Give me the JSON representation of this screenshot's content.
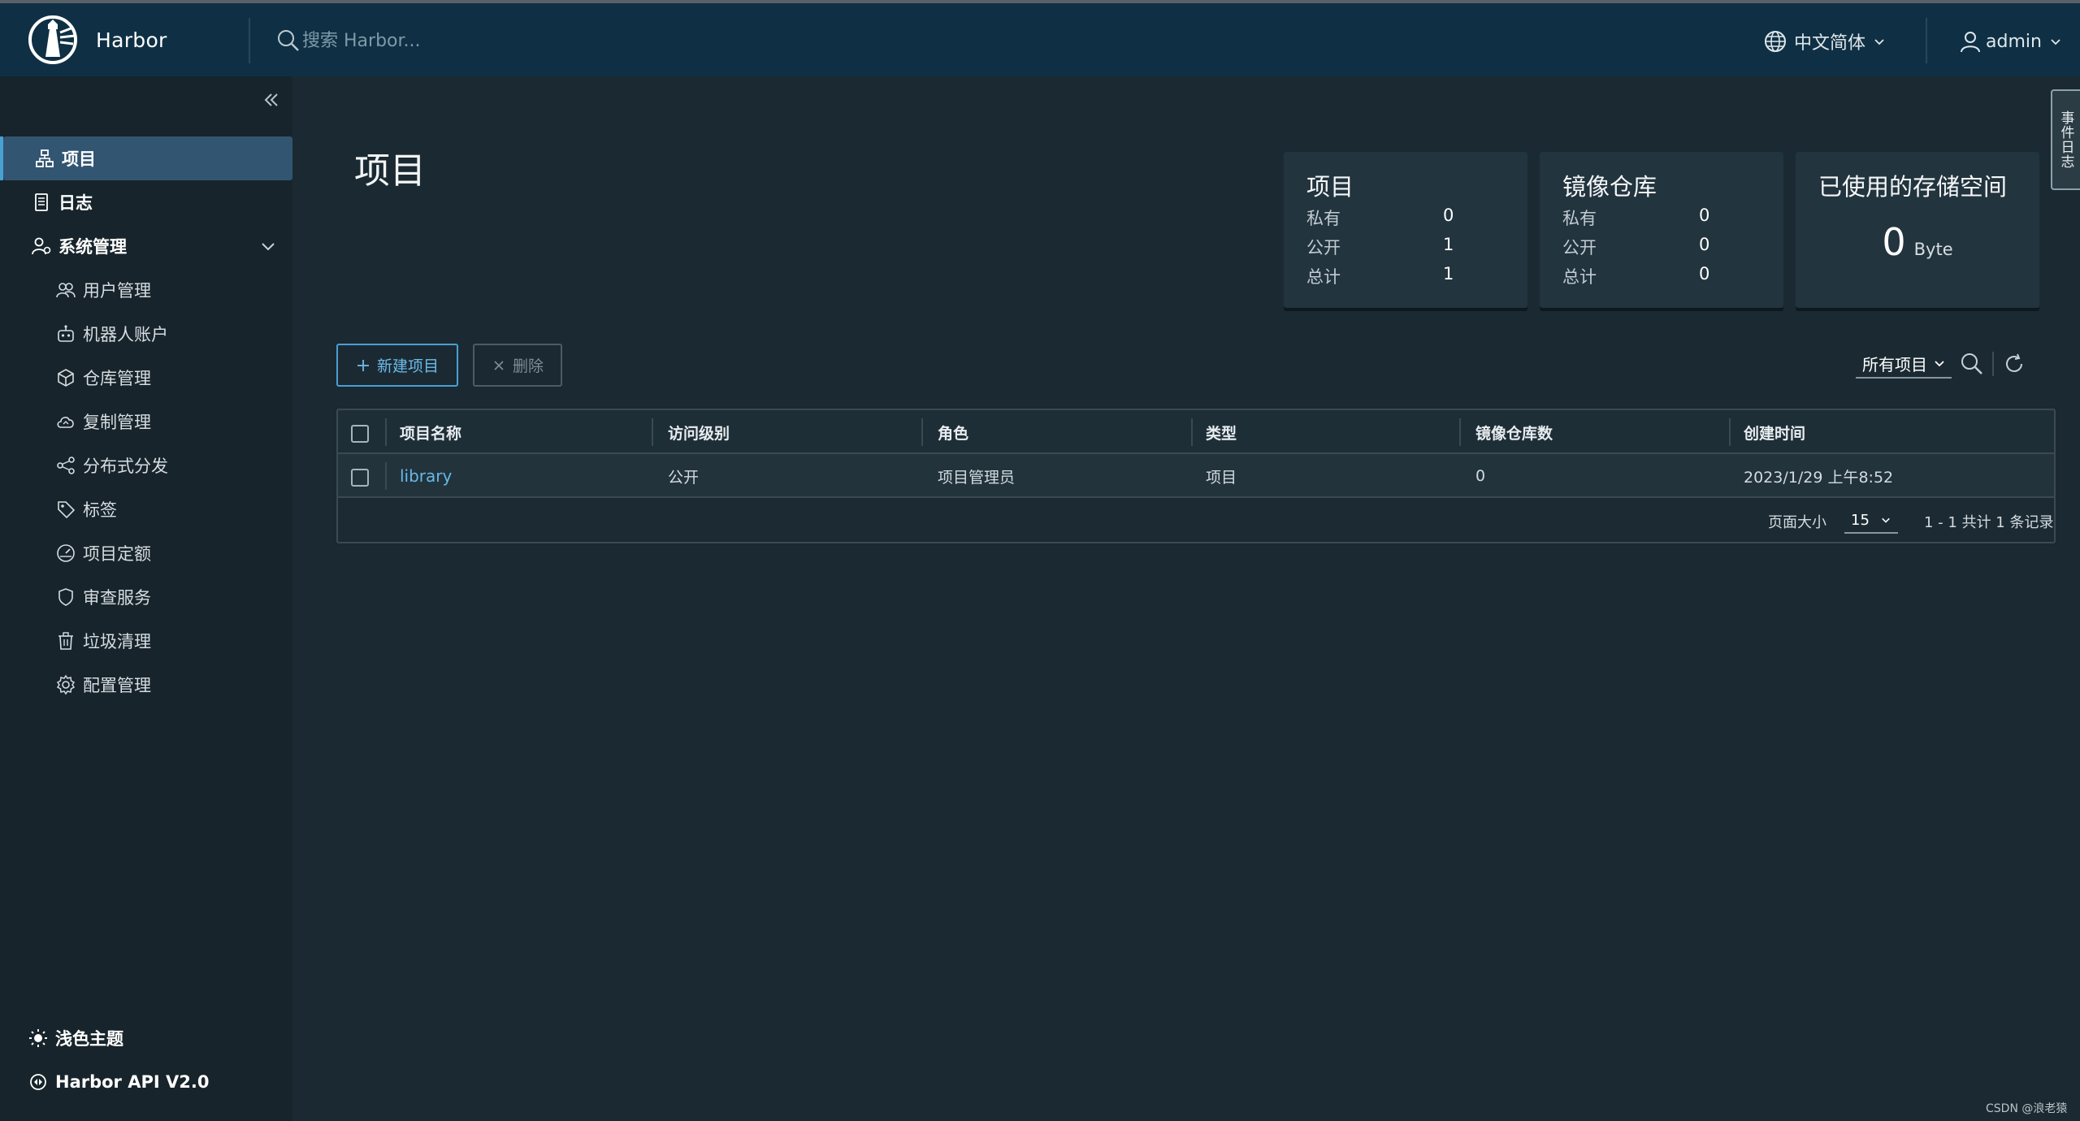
{
  "header": {
    "app_name": "Harbor",
    "search_placeholder": "搜索 Harbor...",
    "language": "中文简体",
    "user": "admin"
  },
  "sidebar": {
    "items": [
      {
        "label": "项目",
        "icon": "project-icon",
        "active": true
      },
      {
        "label": "日志",
        "icon": "log-icon"
      },
      {
        "label": "系统管理",
        "icon": "admin-icon",
        "expanded": true
      }
    ],
    "sub_items": [
      {
        "label": "用户管理",
        "icon": "users-icon"
      },
      {
        "label": "机器人账户",
        "icon": "robot-icon"
      },
      {
        "label": "仓库管理",
        "icon": "box-icon"
      },
      {
        "label": "复制管理",
        "icon": "cloud-sync-icon"
      },
      {
        "label": "分布式分发",
        "icon": "share-icon"
      },
      {
        "label": "标签",
        "icon": "tag-icon"
      },
      {
        "label": "项目定额",
        "icon": "dashboard-icon"
      },
      {
        "label": "审查服务",
        "icon": "shield-icon"
      },
      {
        "label": "垃圾清理",
        "icon": "trash-icon"
      },
      {
        "label": "配置管理",
        "icon": "gear-icon"
      }
    ],
    "footer": {
      "theme_label": "浅色主题",
      "api_label": "Harbor API V2.0"
    }
  },
  "main": {
    "title": "项目",
    "stats": {
      "projects": {
        "title": "项目",
        "rows": [
          {
            "label": "私有",
            "value": "0"
          },
          {
            "label": "公开",
            "value": "1"
          },
          {
            "label": "总计",
            "value": "1"
          }
        ]
      },
      "repositories": {
        "title": "镜像仓库",
        "rows": [
          {
            "label": "私有",
            "value": "0"
          },
          {
            "label": "公开",
            "value": "0"
          },
          {
            "label": "总计",
            "value": "0"
          }
        ]
      },
      "storage": {
        "title": "已使用的存储空间",
        "value": "0",
        "unit": "Byte"
      }
    },
    "actions": {
      "new_project": "新建项目",
      "delete": "删除"
    },
    "filter": {
      "selected": "所有项目"
    },
    "table": {
      "columns": [
        "项目名称",
        "访问级别",
        "角色",
        "类型",
        "镜像仓库数",
        "创建时间"
      ],
      "rows": [
        {
          "name": "library",
          "access": "公开",
          "role": "项目管理员",
          "type": "项目",
          "repo_count": "0",
          "created": "2023/1/29 上午8:52"
        }
      ],
      "footer": {
        "page_size_label": "页面大小",
        "page_size": "15",
        "summary": "1 - 1 共计 1 条记录"
      }
    }
  },
  "event_tab": "事件日志",
  "watermark": "CSDN @浪老猿",
  "colors": {
    "header_bg": "#0f3044",
    "sidebar_bg": "#17242b",
    "main_bg": "#1b2a32",
    "accent": "#4a9fd5",
    "link": "#67b8e8"
  }
}
